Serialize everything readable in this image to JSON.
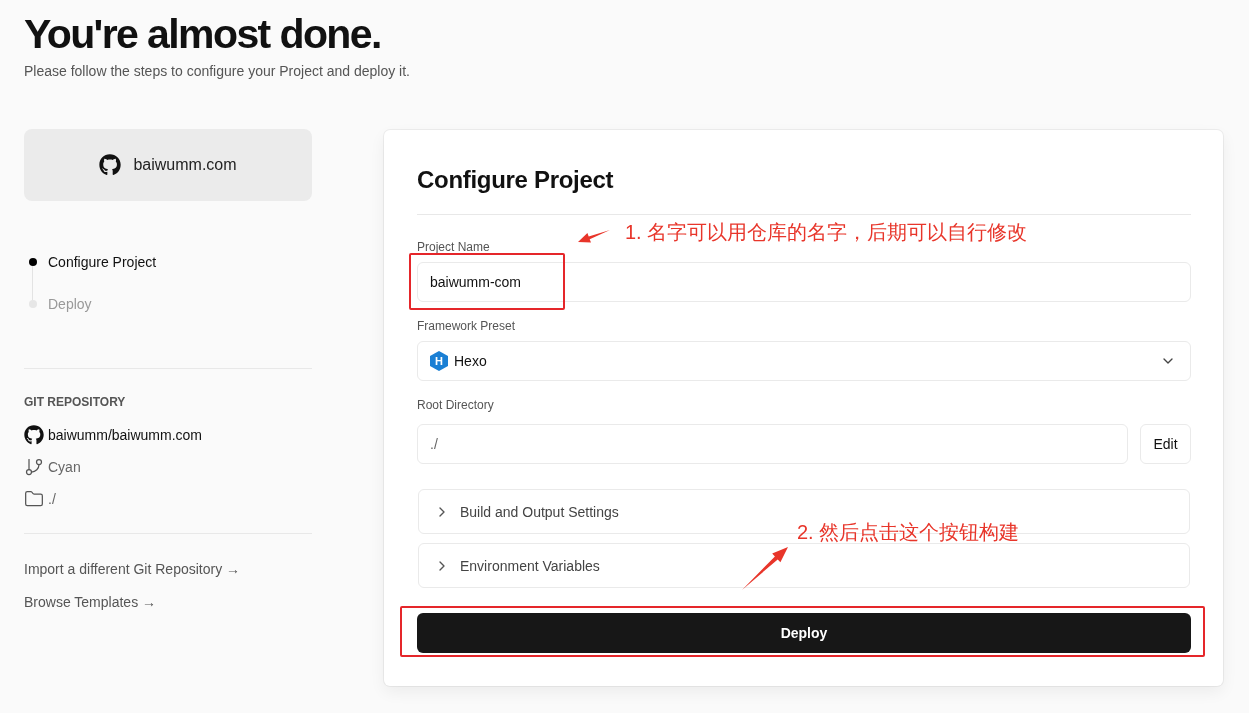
{
  "header": {
    "title": "You're almost done.",
    "subtitle": "Please follow the steps to configure your Project and deploy it."
  },
  "repo_card": {
    "name": "baiwumm.com"
  },
  "steps": [
    {
      "label": "Configure Project",
      "selected": true
    },
    {
      "label": "Deploy",
      "selected": false
    }
  ],
  "git_repository": {
    "heading": "GIT REPOSITORY",
    "items": [
      {
        "kind": "repository",
        "text": "baiwumm/baiwumm.com"
      },
      {
        "kind": "branch",
        "text": "Cyan"
      },
      {
        "kind": "directory",
        "text": "./"
      }
    ]
  },
  "links": [
    "Import a different Git Repository →",
    "Browse Templates →"
  ],
  "configure_project": {
    "title": "Configure Project",
    "fields": [
      {
        "kind": "text",
        "label": "Project Name",
        "value": "baiwumm-com"
      },
      {
        "kind": "select",
        "label": "Framework Preset",
        "value": "Hexo",
        "icon_letter": "H"
      },
      {
        "kind": "text_with_button",
        "label": "Root Directory",
        "value": "./",
        "button": "Edit"
      }
    ],
    "sections": [
      {
        "label": "Build and Output Settings",
        "expanded": false
      },
      {
        "label": "Environment Variables",
        "expanded": false
      }
    ],
    "deploy_button": "Deploy"
  },
  "annotations": [
    "1. 名字可以用仓库的名字，后期可以自行修改",
    "2. 然后点击这个按钮构建"
  ]
}
